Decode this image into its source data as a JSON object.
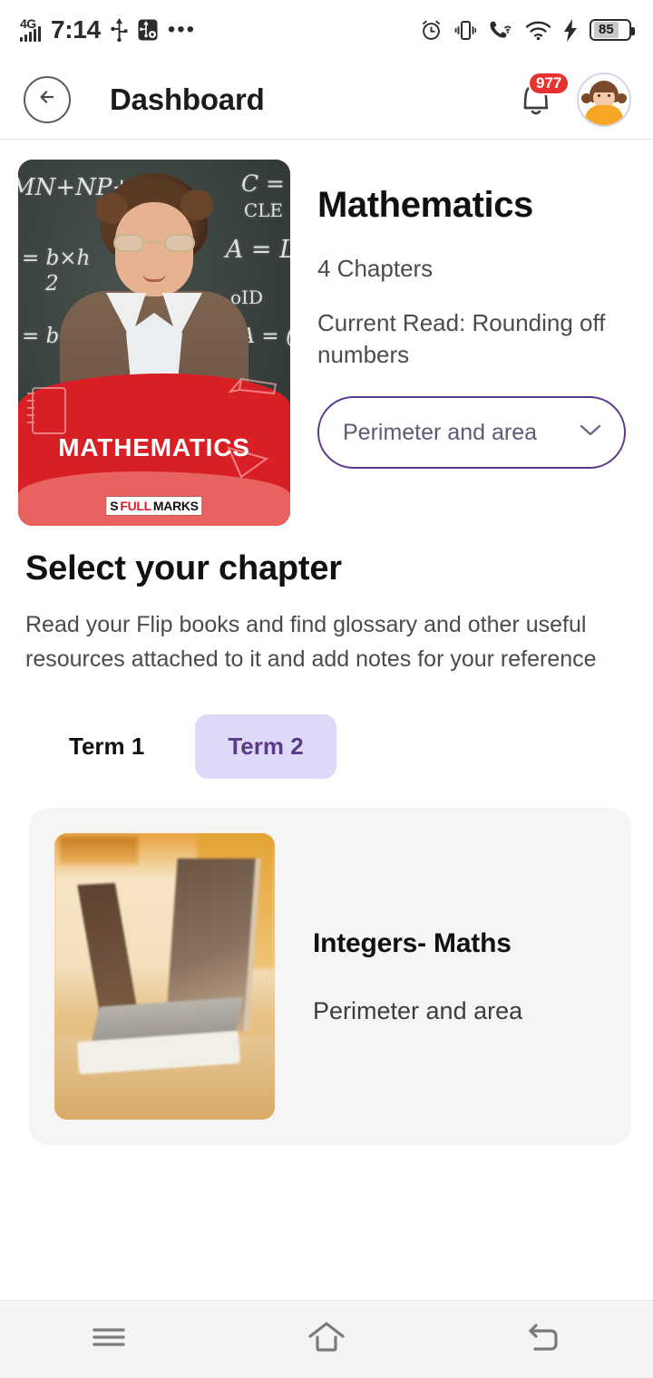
{
  "status_bar": {
    "network": "4G",
    "time": "7:14",
    "icons_left": [
      "signal-icon",
      "usb-icon",
      "usb-debug-icon",
      "more-dots-icon"
    ],
    "icons_right": [
      "alarm-icon",
      "vibrate-icon",
      "wifi-calling-icon",
      "wifi-icon",
      "charging-bolt-icon"
    ],
    "battery_percent": "85"
  },
  "header": {
    "back_icon": "arrow-left-icon",
    "title": "Dashboard",
    "notification_icon": "bell-icon",
    "notification_count": "977",
    "avatar_icon": "user-avatar"
  },
  "subject": {
    "thumbnail_label": "MATHEMATICS",
    "brand_s": "S",
    "brand_full": "FULL",
    "brand_marks": "MARKS",
    "chalk_lines": [
      "MN+NP+PN",
      "= b×h",
      "2",
      "?",
      "A = L",
      "CLE",
      "oID",
      "= b×h",
      "A = (",
      "C ="
    ],
    "title": "Mathematics",
    "chapters_count": "4 Chapters",
    "current_read": "Current Read: Rounding off numbers",
    "selected_chapter": "Perimeter and area",
    "dropdown_icon": "chevron-down-icon"
  },
  "section": {
    "title": "Select your chapter",
    "description": "Read your Flip books and find glossary and other useful resources attached to it and add notes for your reference"
  },
  "terms": [
    {
      "label": "Term 1",
      "active": false
    },
    {
      "label": "Term 2",
      "active": true
    }
  ],
  "chapter_cards": [
    {
      "name": "Integers- Maths",
      "subtitle": "Perimeter and area",
      "thumbnail": "laptop-on-desk-photo"
    }
  ],
  "nav_bar": {
    "recents_icon": "menu-icon",
    "home_icon": "home-icon",
    "back_icon": "back-arrow-icon"
  },
  "colors": {
    "accent_purple": "#5B3A87",
    "tab_active_bg": "#DCDAF7",
    "badge_red": "#E8322F",
    "brand_red": "#D81F26",
    "card_bg": "#F5F5F5"
  }
}
